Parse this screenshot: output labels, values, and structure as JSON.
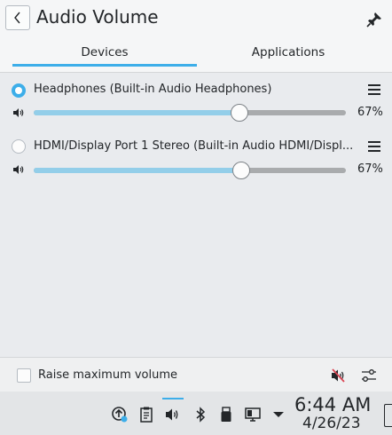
{
  "window": {
    "title": "Audio Volume",
    "back_icon": "chevron-left-icon",
    "pin_icon": "pin-icon"
  },
  "tabs": [
    {
      "label": "Devices",
      "active": true
    },
    {
      "label": "Applications",
      "active": false
    }
  ],
  "devices": [
    {
      "name": "Headphones (Built-in Audio Headphones)",
      "default": true,
      "volume": 67,
      "volume_label": "67%"
    },
    {
      "name": "HDMI/Display Port 1 Stereo (Built-in Audio HDMI/Displ...",
      "default": false,
      "volume": 67,
      "volume_label": "67%"
    }
  ],
  "footer": {
    "raise_max_volume_label": "Raise maximum volume",
    "raise_max_volume_checked": false,
    "mute_icon": "speaker-muted-icon",
    "config_icon": "settings-sliders-icon"
  },
  "taskbar": {
    "time": "6:44 AM",
    "date": "4/26/23",
    "tray_icons": [
      "updates-icon",
      "clipboard-icon",
      "volume-icon",
      "bluetooth-icon",
      "usb-drive-icon",
      "display-icon",
      "expand-arrow-icon"
    ]
  },
  "colors": {
    "accent": "#3daee9",
    "slider_fill": "#93cee9",
    "slider_track": "#a9abad",
    "mute_red": "#da4453"
  }
}
